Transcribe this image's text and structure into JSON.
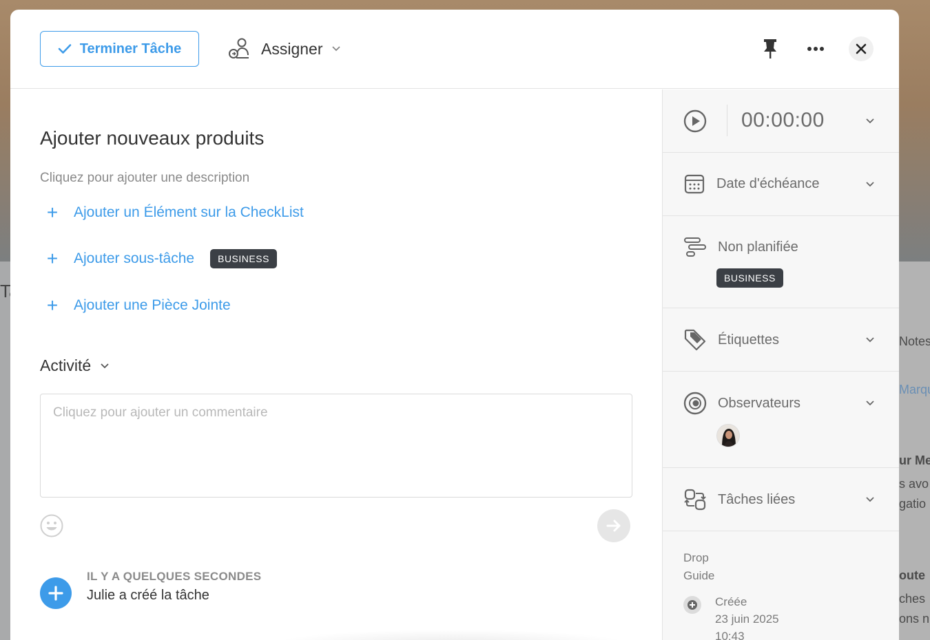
{
  "header": {
    "complete_label": "Terminer Tâche",
    "assign_label": "Assigner"
  },
  "task": {
    "title": "Ajouter nouveaux produits",
    "description_placeholder": "Cliquez pour ajouter une description"
  },
  "actions": {
    "checklist": "Ajouter un Élément sur la CheckList",
    "subtask": "Ajouter sous-tâche",
    "subtask_badge": "BUSINESS",
    "attachment": "Ajouter une Pièce Jointe"
  },
  "activity": {
    "label": "Activité",
    "comment_placeholder": "Cliquez pour ajouter un commentaire",
    "feed": [
      {
        "time": "IL Y A QUELQUES SECONDES",
        "text": "Julie a créé la tâche"
      }
    ]
  },
  "sidebar": {
    "timer": "00:00:00",
    "due_date": "Date d'échéance",
    "schedule": "Non planifiée",
    "schedule_badge": "BUSINESS",
    "tags": "Étiquettes",
    "watchers": "Observateurs",
    "linked": "Tâches liées",
    "project_line1": "Drop",
    "project_line2": "Guide",
    "created_label": "Créée",
    "created_date": "23 juin 2025",
    "created_time": "10:43"
  },
  "background": {
    "left_text": "Ta",
    "right_texts": [
      "Notes",
      "Marqu",
      "ur Me",
      "s avo",
      "gatio",
      "oute",
      "ches",
      "ons n"
    ]
  },
  "colors": {
    "accent": "#3d9be9",
    "badge": "#3b3f45"
  }
}
